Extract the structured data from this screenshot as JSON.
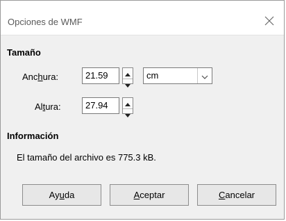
{
  "window": {
    "title": "Opciones de WMF",
    "close_icon": "close-icon"
  },
  "size_section": {
    "header": "Tamaño",
    "width": {
      "label_pre": "Anc",
      "label_mnemonic": "h",
      "label_post": "ura:",
      "value": "21.59"
    },
    "height": {
      "label_pre": "Al",
      "label_mnemonic": "t",
      "label_post": "ura:",
      "value": "27.94"
    },
    "unit": {
      "selected": "cm"
    }
  },
  "info_section": {
    "header": "Información",
    "text": "El tamaño del archivo es 775.3 kB."
  },
  "buttons": {
    "help": {
      "pre": "Ay",
      "mnemonic": "u",
      "post": "da"
    },
    "ok": {
      "pre": "",
      "mnemonic": "A",
      "post": "ceptar"
    },
    "cancel": {
      "pre": "",
      "mnemonic": "C",
      "post": "ancelar"
    }
  }
}
